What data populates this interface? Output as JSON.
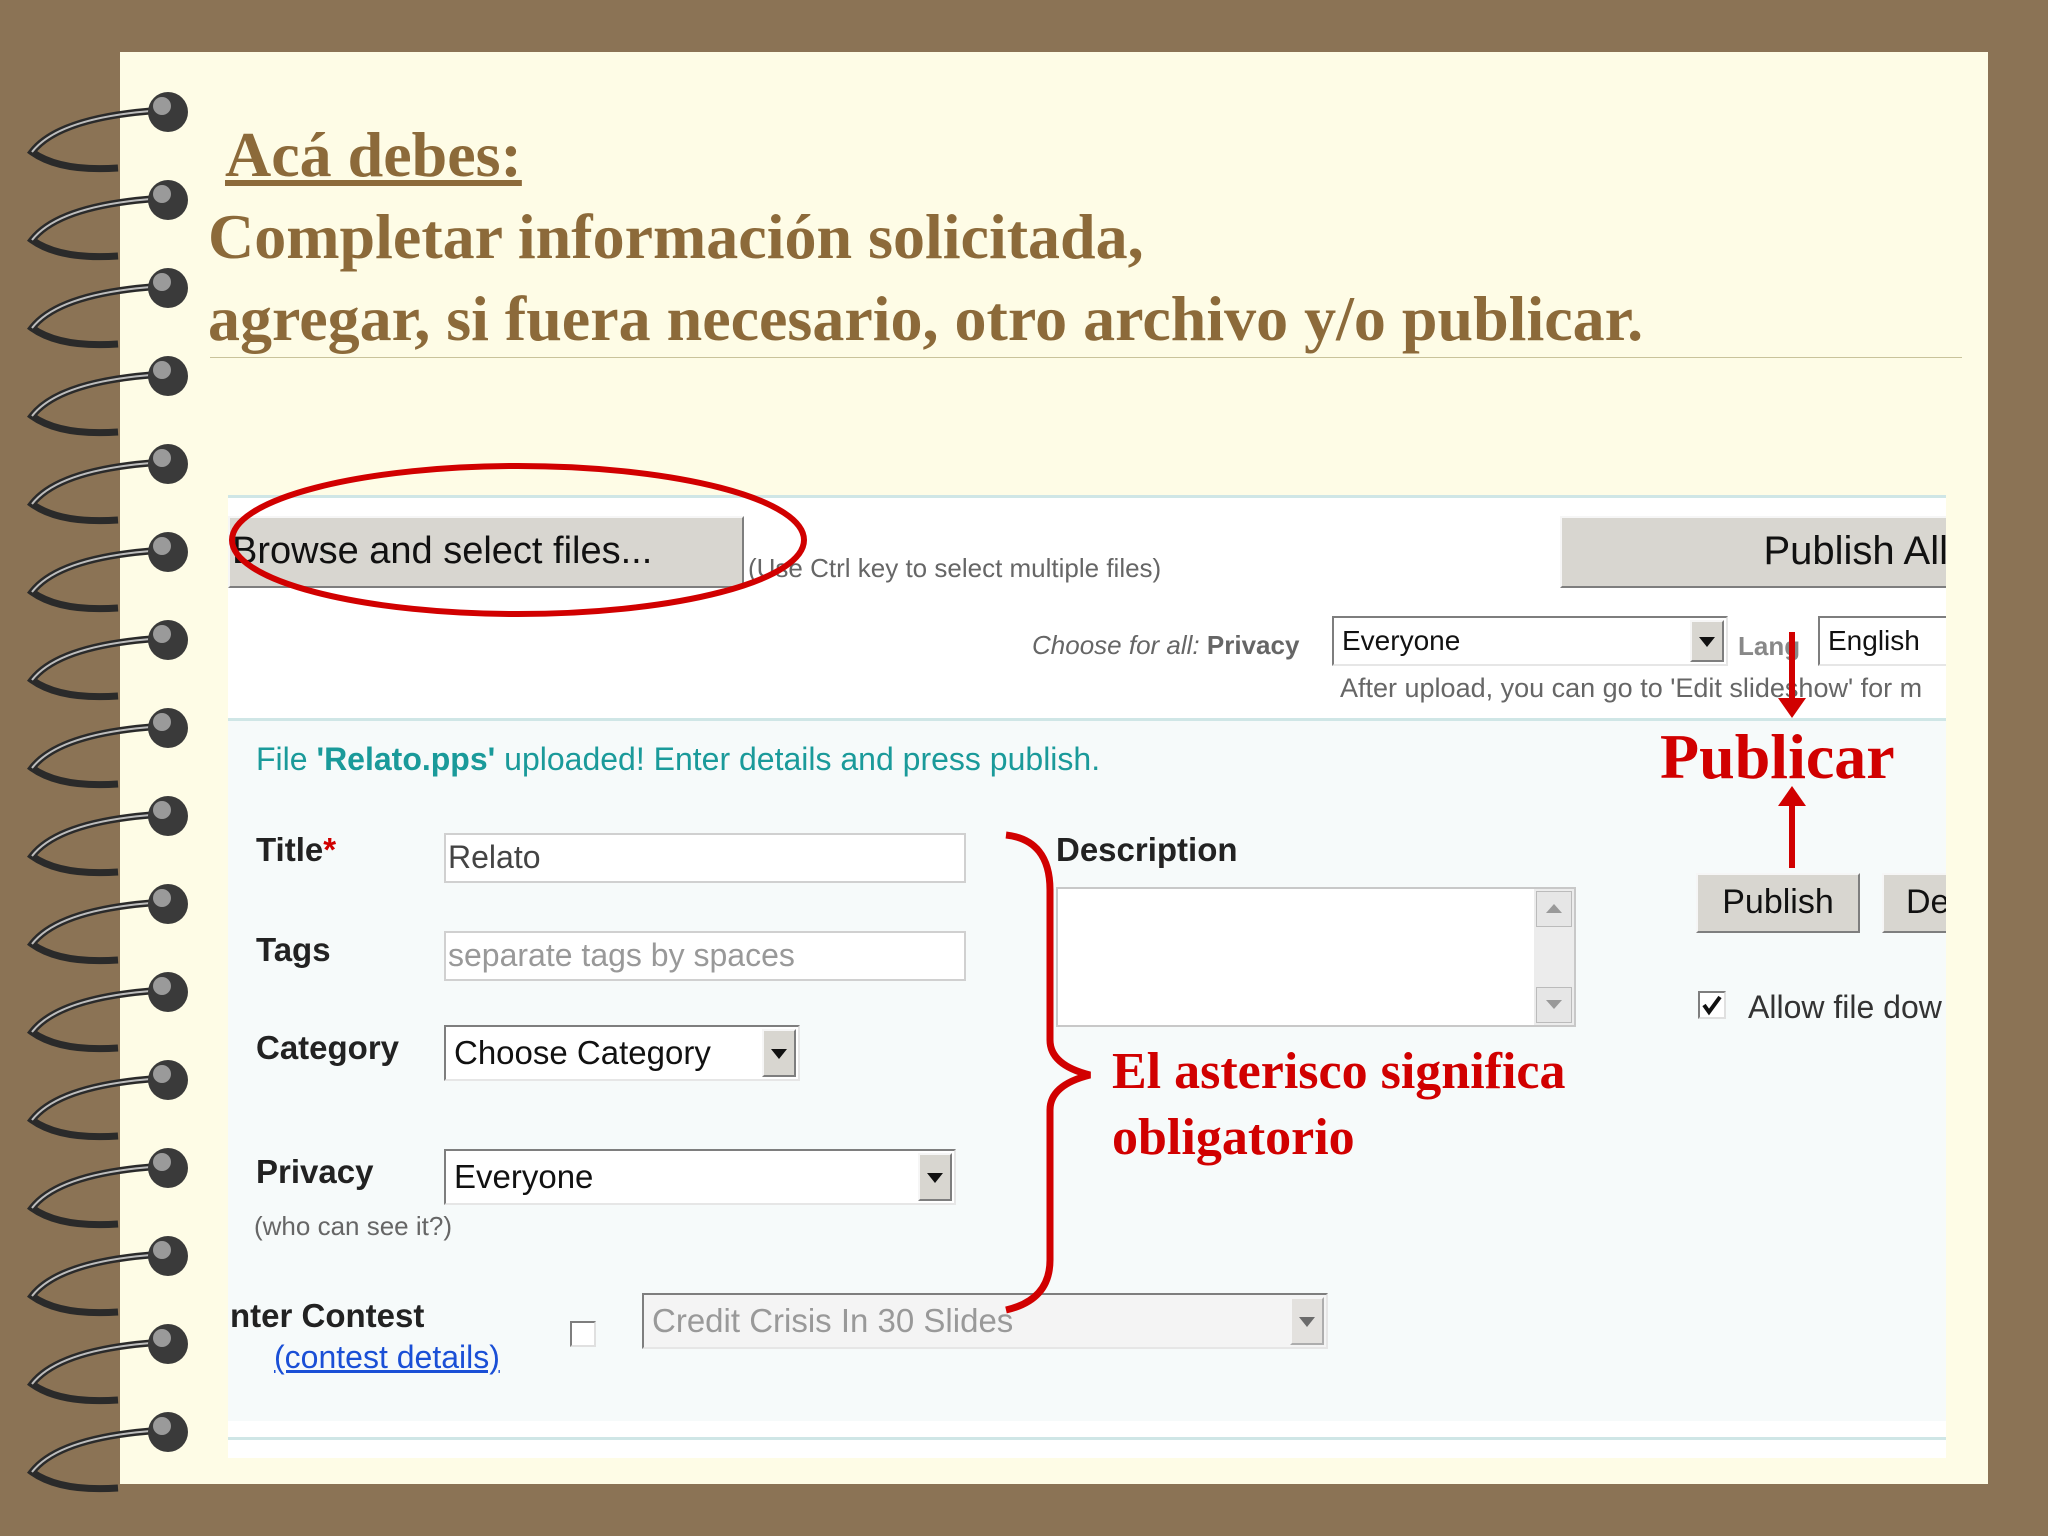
{
  "slide": {
    "heading": "Acá debes:",
    "line1": "Completar información solicitada,",
    "line2": "agregar, si fuera necesario, otro archivo y/o publicar."
  },
  "uploader": {
    "browse_label": "Browse and select files...",
    "browse_hint": "(Use Ctrl key to select multiple files)",
    "publish_all_label": "Publish All",
    "choose_for_all": "Choose for all:",
    "privacy_label": "Privacy",
    "privacy_all_value": "Everyone",
    "lang_label": "Lang",
    "lang_value": "English",
    "after_upload_note": "After upload, you can go to 'Edit slideshow' for m"
  },
  "file_panel": {
    "status_prefix": "File ",
    "file_name": "'Relato.pps'",
    "status_suffix": " uploaded! Enter details and press publish.",
    "title_label": "Title",
    "required_mark": "*",
    "title_value": "Relato",
    "tags_label": "Tags",
    "tags_placeholder": "separate tags by spaces",
    "category_label": "Category",
    "category_value": "Choose Category",
    "privacy_label": "Privacy",
    "privacy_value": "Everyone",
    "privacy_hint": "(who can see it?)",
    "contest_label": "nter Contest",
    "contest_link": "(contest details)",
    "contest_value": "Credit Crisis In 30 Slides",
    "description_label": "Description",
    "publish_label": "Publish",
    "delete_label": "De",
    "allow_download_label": "Allow file dow"
  },
  "annotations": {
    "publicar": "Publicar",
    "asterisk_note_line1": "El asterisco significa",
    "asterisk_note_line2": "obligatorio"
  },
  "colors": {
    "background": "#8b7355",
    "paper": "#fefce6",
    "heading": "#8c6a3a",
    "annotation_red": "#d10000",
    "status_teal": "#1a9a9a",
    "link_blue": "#1a4fd6"
  }
}
